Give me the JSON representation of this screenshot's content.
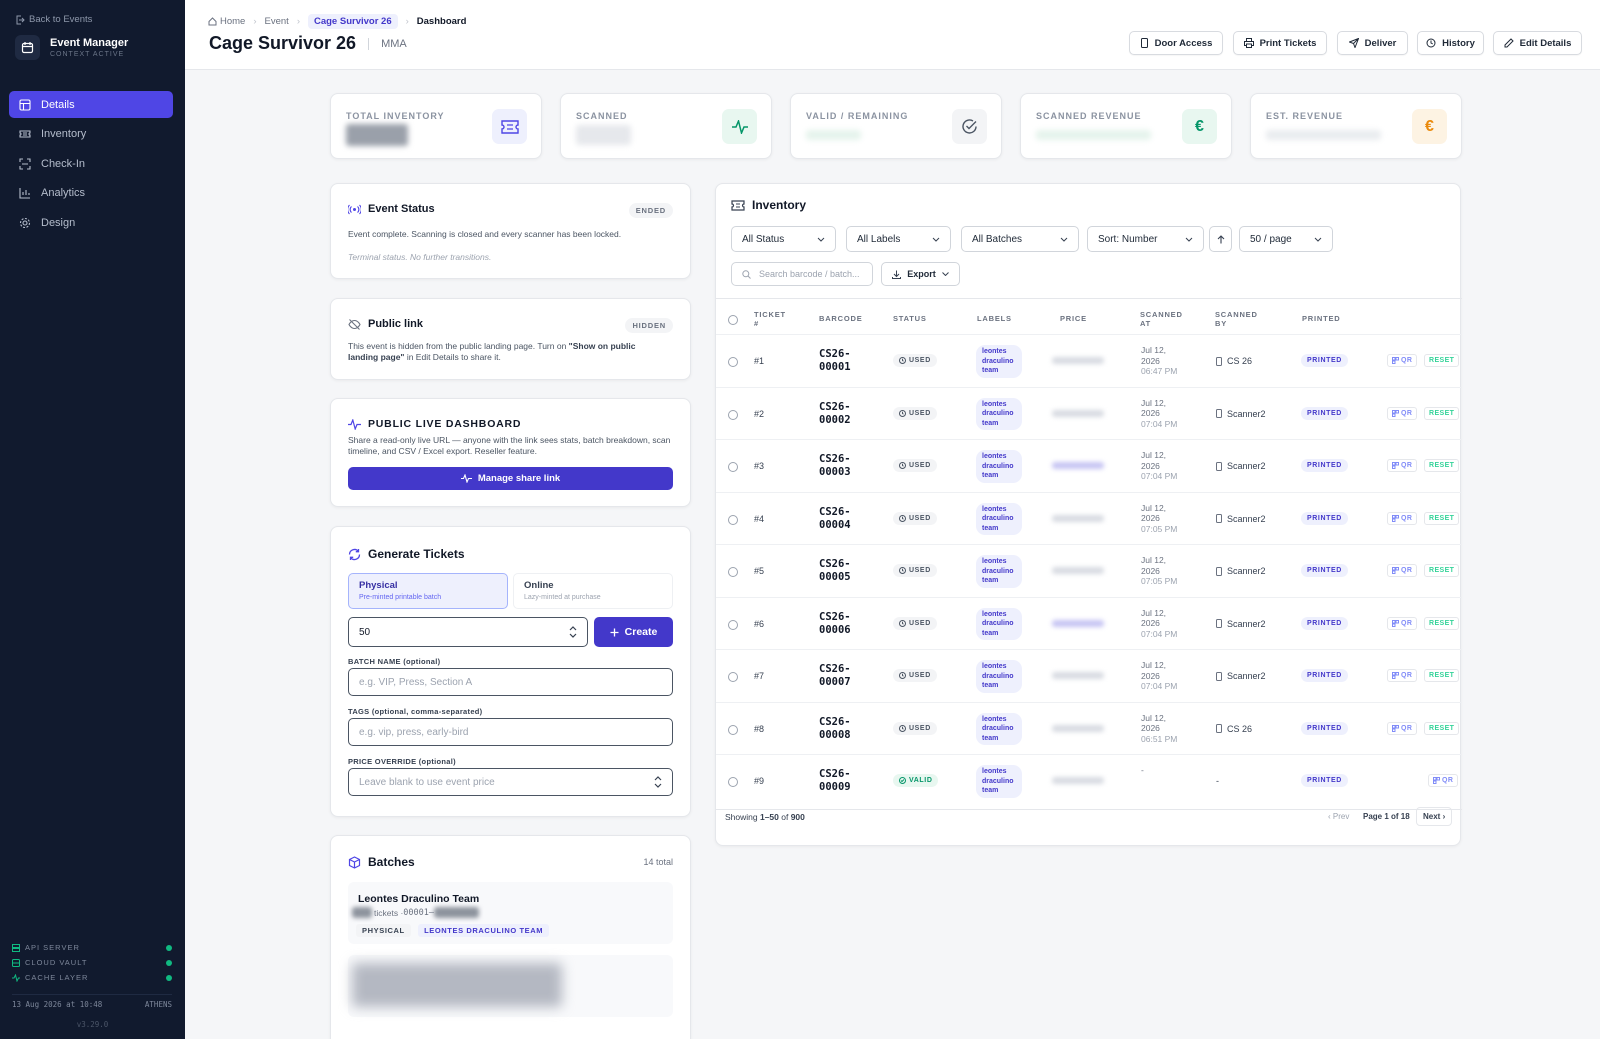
{
  "sidebar": {
    "back_label": "Back to Events",
    "brand_title": "Event Manager",
    "brand_sub": "CONTEXT ACTIVE",
    "nav": [
      {
        "label": "Details",
        "icon": "layout-icon",
        "active": true
      },
      {
        "label": "Inventory",
        "icon": "ticket-icon",
        "active": false
      },
      {
        "label": "Check-In",
        "icon": "scan-icon",
        "active": false
      },
      {
        "label": "Analytics",
        "icon": "bar-chart-icon",
        "active": false
      },
      {
        "label": "Design",
        "icon": "gear-icon",
        "active": false
      }
    ],
    "system": [
      {
        "label": "API SERVER",
        "status": "online"
      },
      {
        "label": "CLOUD VAULT",
        "status": "online"
      },
      {
        "label": "CACHE LAYER",
        "status": "online"
      }
    ],
    "clock": "13 Aug 2026 at 10:48",
    "location": "ATHENS",
    "version": "v3.29.0"
  },
  "header": {
    "breadcrumb": [
      "Home",
      "Event",
      "Cage Survivor 26",
      "Dashboard"
    ],
    "title": "Cage Survivor 26",
    "subtitle": "MMA",
    "actions": [
      "Door Access",
      "Print Tickets",
      "Deliver",
      "History",
      "Edit Details"
    ]
  },
  "stats": [
    {
      "label": "TOTAL INVENTORY",
      "icon": "ticket-icon",
      "accent": "#4f46e5"
    },
    {
      "label": "SCANNED",
      "icon": "activity-icon",
      "accent": "#059669"
    },
    {
      "label": "VALID / REMAINING",
      "icon": "check-circle-icon",
      "accent": "#6b7280"
    },
    {
      "label": "SCANNED REVENUE",
      "icon": "euro-icon",
      "glyph": "€",
      "accent": "#059669"
    },
    {
      "label": "EST. REVENUE",
      "icon": "euro-icon",
      "glyph": "€",
      "accent": "#ea8a0c"
    }
  ],
  "event_status": {
    "title": "Event Status",
    "badge": "ENDED",
    "text": "Event complete. Scanning is closed and every scanner has been locked.",
    "note": "Terminal status. No further transitions."
  },
  "public_link": {
    "title": "Public link",
    "badge": "HIDDEN",
    "text_a": "This event is hidden from the public landing page. Turn on ",
    "text_b": "\"Show on public landing page\"",
    "text_c": " in Edit Details to share it."
  },
  "live_dashboard": {
    "title": "PUBLIC LIVE DASHBOARD",
    "text": "Share a read-only live URL — anyone with the link sees stats, batch breakdown, scan timeline, and CSV / Excel export. Reseller feature.",
    "button": "Manage share link"
  },
  "generate": {
    "title": "Generate Tickets",
    "modes": [
      {
        "title": "Physical",
        "sub": "Pre-minted printable batch",
        "selected": true
      },
      {
        "title": "Online",
        "sub": "Lazy-minted at purchase",
        "selected": false
      }
    ],
    "quantity": "50",
    "create": "Create",
    "batch_label": "BATCH NAME (optional)",
    "batch_placeholder": "e.g. VIP, Press, Section A",
    "tags_label": "TAGS (optional, comma-separated)",
    "tags_placeholder": "e.g. vip, press, early-bird",
    "price_label": "PRICE OVERRIDE (optional)",
    "price_placeholder": "Leave blank to use event price"
  },
  "batches": {
    "title": "Batches",
    "count": "14 total",
    "items": [
      {
        "name": "Leontes Draculino Team",
        "meta_a": "tickets · ",
        "meta_b": "00001–",
        "tags": [
          "PHYSICAL",
          "LEONTES DRACULINO TEAM"
        ]
      }
    ]
  },
  "inventory": {
    "title": "Inventory",
    "filters": [
      "All Status",
      "All Labels",
      "All Batches",
      "Sort: Number",
      "50 / page"
    ],
    "search_placeholder": "Search barcode / batch...",
    "export": "Export",
    "columns": [
      "TICKET #",
      "BARCODE",
      "STATUS",
      "LABELS",
      "PRICE",
      "SCANNED AT",
      "SCANNED BY",
      "PRINTED"
    ],
    "rows": [
      {
        "num": "#1",
        "bc1": "CS26-",
        "bc2": "00001",
        "status": "USED",
        "label": "leontes draculino team",
        "d1": "Jul 12,",
        "d2": "2026",
        "d3": "06:47 PM",
        "by": "CS 26",
        "printed": "PRINTED",
        "qr": "QR",
        "reset": "RESET"
      },
      {
        "num": "#2",
        "bc1": "CS26-",
        "bc2": "00002",
        "status": "USED",
        "label": "leontes draculino team",
        "d1": "Jul 12,",
        "d2": "2026",
        "d3": "07:04 PM",
        "by": "Scanner2",
        "printed": "PRINTED",
        "qr": "QR",
        "reset": "RESET"
      },
      {
        "num": "#3",
        "bc1": "CS26-",
        "bc2": "00003",
        "status": "USED",
        "label": "leontes draculino team",
        "d1": "Jul 12,",
        "d2": "2026",
        "d3": "07:04 PM",
        "by": "Scanner2",
        "printed": "PRINTED",
        "qr": "QR",
        "reset": "RESET"
      },
      {
        "num": "#4",
        "bc1": "CS26-",
        "bc2": "00004",
        "status": "USED",
        "label": "leontes draculino team",
        "d1": "Jul 12,",
        "d2": "2026",
        "d3": "07:05 PM",
        "by": "Scanner2",
        "printed": "PRINTED",
        "qr": "QR",
        "reset": "RESET"
      },
      {
        "num": "#5",
        "bc1": "CS26-",
        "bc2": "00005",
        "status": "USED",
        "label": "leontes draculino team",
        "d1": "Jul 12,",
        "d2": "2026",
        "d3": "07:05 PM",
        "by": "Scanner2",
        "printed": "PRINTED",
        "qr": "QR",
        "reset": "RESET"
      },
      {
        "num": "#6",
        "bc1": "CS26-",
        "bc2": "00006",
        "status": "USED",
        "label": "leontes draculino team",
        "d1": "Jul 12,",
        "d2": "2026",
        "d3": "07:04 PM",
        "by": "Scanner2",
        "printed": "PRINTED",
        "qr": "QR",
        "reset": "RESET"
      },
      {
        "num": "#7",
        "bc1": "CS26-",
        "bc2": "00007",
        "status": "USED",
        "label": "leontes draculino team",
        "d1": "Jul 12,",
        "d2": "2026",
        "d3": "07:04 PM",
        "by": "Scanner2",
        "printed": "PRINTED",
        "qr": "QR",
        "reset": "RESET"
      },
      {
        "num": "#8",
        "bc1": "CS26-",
        "bc2": "00008",
        "status": "USED",
        "label": "leontes draculino team",
        "d1": "Jul 12,",
        "d2": "2026",
        "d3": "06:51 PM",
        "by": "CS 26",
        "printed": "PRINTED",
        "qr": "QR",
        "reset": "RESET"
      },
      {
        "num": "#9",
        "bc1": "CS26-",
        "bc2": "00009",
        "status": "VALID",
        "label": "leontes draculino team",
        "d1": "-",
        "d2": "",
        "d3": "",
        "by": "-",
        "printed": "PRINTED",
        "qr": "QR",
        "reset": ""
      }
    ],
    "footer_a": "Showing ",
    "footer_range": "1–50",
    "footer_b": " of ",
    "footer_total": "900",
    "prev": "‹ Prev",
    "page": "Page 1 of 18",
    "next": "Next ›"
  }
}
